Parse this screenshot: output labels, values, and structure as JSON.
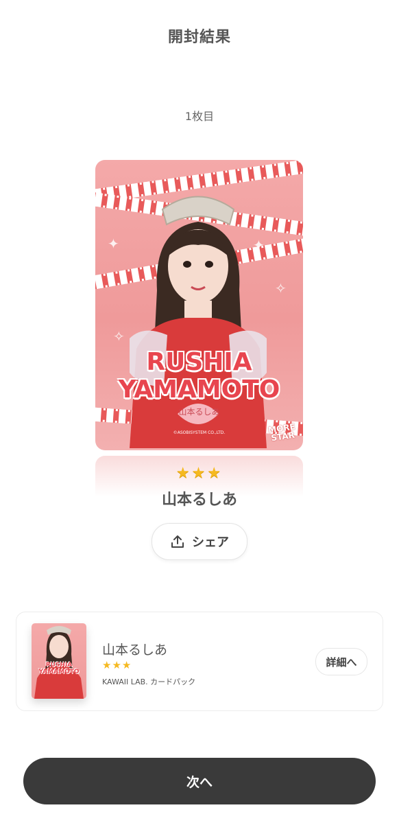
{
  "header": {
    "title": "開封結果"
  },
  "result": {
    "index_label": "1枚目",
    "card": {
      "name_en_line1": "RUSHIA",
      "name_en_line2": "YAMAMOTO",
      "name_jp": "山本るしあ",
      "brand_line1": "MORE",
      "brand_line2": "STAR",
      "copyright": "©ASOBISYSTEM CO.,LTD."
    },
    "rarity_stars": "★★★",
    "name": "山本るしあ",
    "share_label": "シェア",
    "share_icon": "share-upload-icon"
  },
  "summary": {
    "thumb_line1": "RUSHIA",
    "thumb_line2": "YAMAMOTO",
    "name": "山本るしあ",
    "stars": "★★★",
    "pack": "KAWAII LAB. カードパック",
    "details_label": "詳細へ"
  },
  "footer": {
    "next_label": "次へ"
  },
  "colors": {
    "card_pink": "#ef9a9a",
    "name_red": "#e8454f",
    "star_gold": "#f5b921",
    "button_dark": "#3a3a3a"
  }
}
